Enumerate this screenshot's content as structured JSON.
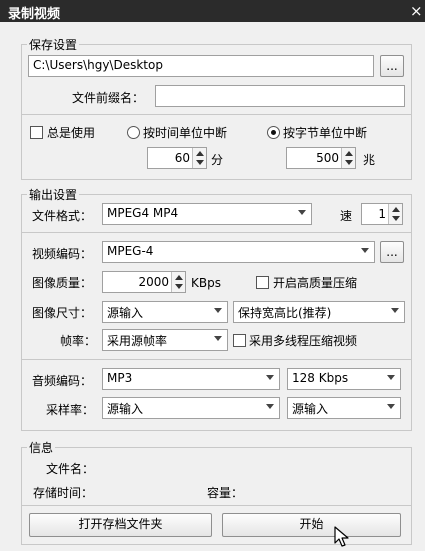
{
  "window": {
    "title": "录制视频",
    "close_glyph": "×"
  },
  "save": {
    "group_label": "保存设置",
    "path_value": "C:\\Users\\hgy\\Desktop",
    "browse_label": "...",
    "prefix_label": "文件前缀名：",
    "prefix_value": "",
    "always_use_label": "总是使用",
    "always_use_checked": false,
    "by_time_label": "按时间单位中断",
    "by_time_selected": false,
    "by_bytes_label": "按字节单位中断",
    "by_bytes_selected": true,
    "time_value": "60",
    "time_unit": "分",
    "bytes_value": "500",
    "bytes_unit": "兆"
  },
  "output": {
    "group_label": "输出设置",
    "format_label": "文件格式：",
    "format_value": "MPEG4 MP4",
    "speed_label": "速",
    "speed_value": "1",
    "video_codec_label": "视频编码：",
    "video_codec_value": "MPEG-4",
    "codec_browse_label": "...",
    "quality_label": "图像质量：",
    "quality_value": "2000",
    "quality_unit": "KBps",
    "hq_label": "开启高质量压缩",
    "hq_checked": false,
    "size_label": "图像尺寸：",
    "size_value": "源输入",
    "aspect_value": "保持宽高比(推荐)",
    "fps_label": "帧率：",
    "fps_value": "采用源帧率",
    "multithread_label": "采用多线程压缩视频",
    "multithread_checked": false,
    "audio_codec_label": "音频编码：",
    "audio_codec_value": "MP3",
    "audio_bitrate_value": "128 Kbps",
    "sample_rate_label": "采样率：",
    "sample_rate_value": "源输入",
    "channels_value": "源输入"
  },
  "info": {
    "group_label": "信息",
    "filename_label": "文件名：",
    "duration_label": "存储时间：",
    "size_label": "容量：",
    "open_folder_label": "打开存档文件夹",
    "start_label": "开始"
  },
  "icons": {
    "cursor": "mouse-pointer-icon"
  }
}
